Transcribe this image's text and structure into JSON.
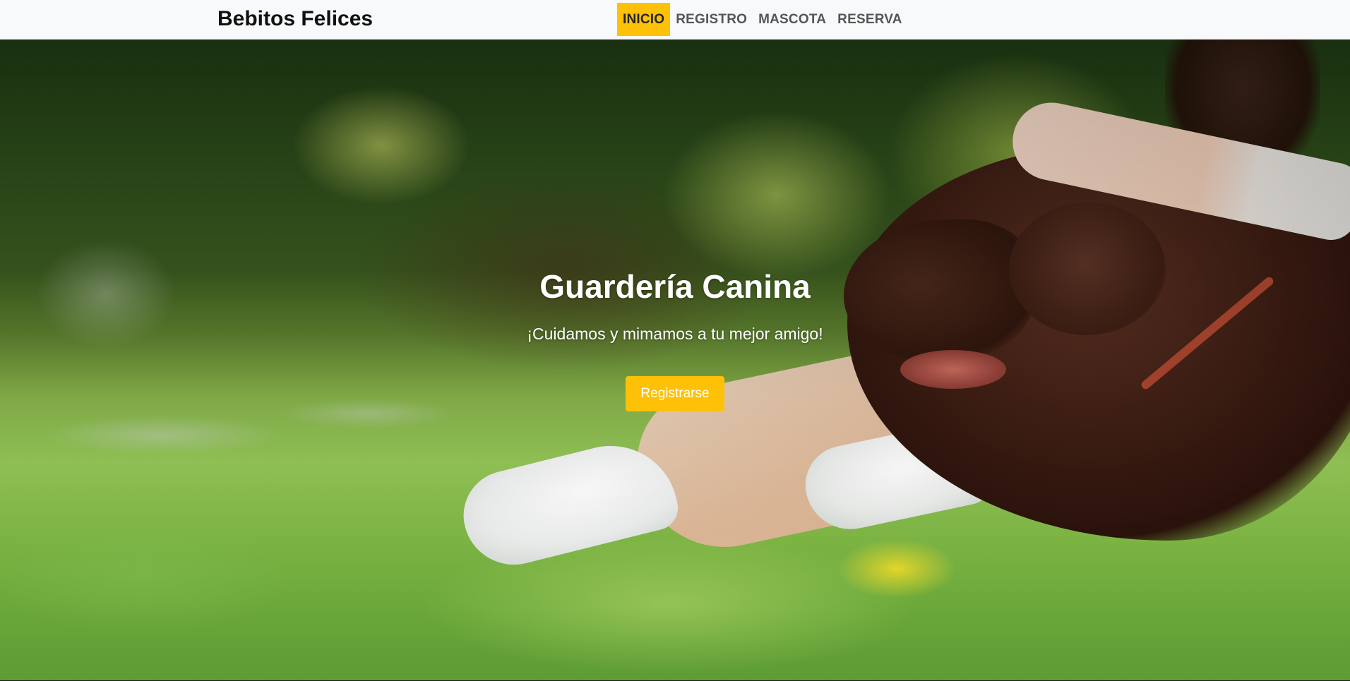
{
  "navbar": {
    "brand": "Bebitos Felices",
    "items": [
      {
        "label": "INICIO",
        "active": true
      },
      {
        "label": "REGISTRO",
        "active": false
      },
      {
        "label": "MASCOTA",
        "active": false
      },
      {
        "label": "RESERVA",
        "active": false
      }
    ],
    "active_color": "#ffc107",
    "background": "#f8f9fa"
  },
  "hero": {
    "title": "Guardería Canina",
    "subtitle": "¡Cuidamos y mimamos a tu mejor amigo!",
    "cta_label": "Registrarse",
    "cta_color": "#ffc107",
    "background_image": "dog-with-owner-on-grass-photo"
  }
}
